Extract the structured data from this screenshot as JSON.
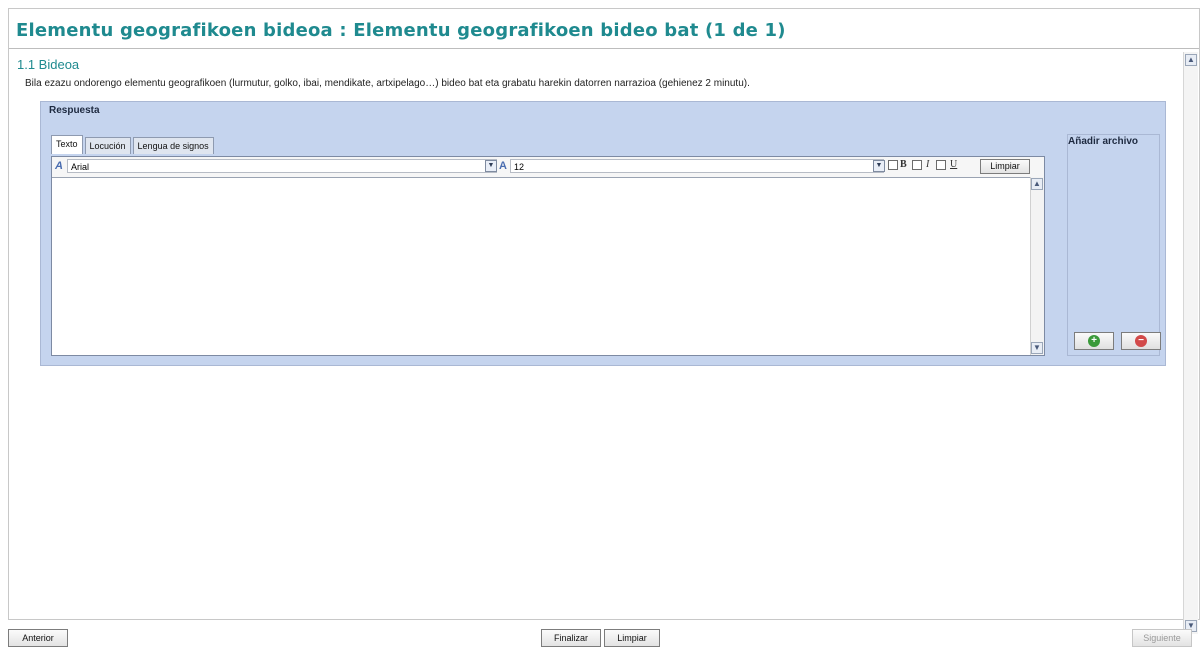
{
  "header": {
    "title": "Elementu geografikoen bideoa : Elementu geografikoen bideo bat (1 de 1)"
  },
  "section": {
    "heading": "1.1 Bideoa",
    "instructions": "Bila ezazu ondorengo elementu geografikoen (lurmutur, golko, ibai, mendikate, artxipelago…) bideo bat eta grabatu harekin datorren narrazioa (gehienez 2 minutu)."
  },
  "answer": {
    "label": "Respuesta",
    "tabs": [
      "Texto",
      "Locución",
      "Lengua de signos"
    ],
    "active_tab": "Texto",
    "toolbar": {
      "font_value": "Arial",
      "size_value": "12",
      "bold_label": "B",
      "italic_label": "I",
      "underline_label": "U",
      "clear_label": "Limpiar"
    },
    "editor_text": ""
  },
  "attachments": {
    "title": "Añadir archivo",
    "add_icon": "plus-icon",
    "remove_icon": "minus-icon"
  },
  "footer": {
    "previous_label": "Anterior",
    "finish_label": "Finalizar",
    "clear_label": "Limpiar",
    "next_label": "Siguiente"
  },
  "colors": {
    "title": "#1f8a8f",
    "panel": "#c5d4ee",
    "add": "#3a9a3a",
    "remove": "#d24a4a"
  }
}
